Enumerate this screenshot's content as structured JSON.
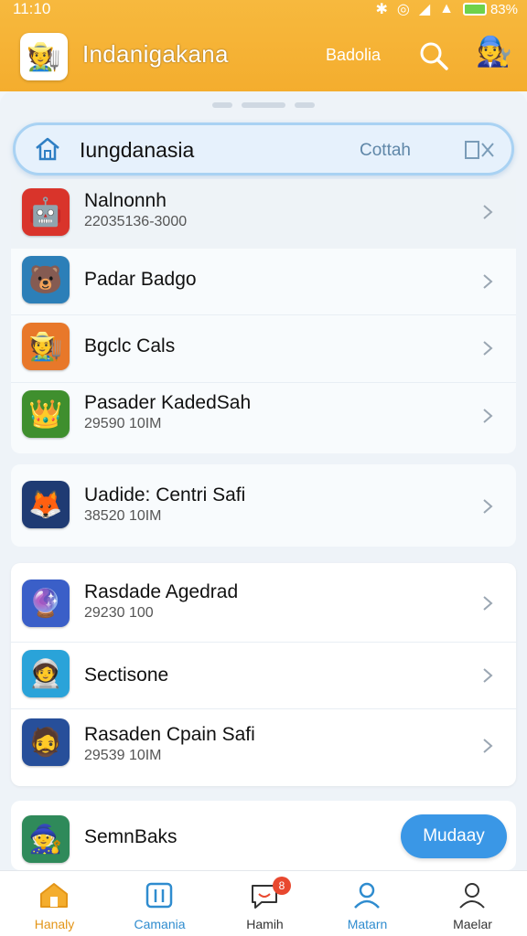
{
  "status_bar": {
    "time": "11:10",
    "battery": "83%"
  },
  "header": {
    "title": "Indanigakana",
    "link": "Badolia",
    "logo_icon": "game-character-icon",
    "avatar_icon": "character-avatar-icon"
  },
  "search": {
    "query": "Iungdanasia",
    "action": "Cottah"
  },
  "items": [
    {
      "title": "Nalnonnh",
      "subtitle": "22035136-3000",
      "icon": "🤖",
      "bg": "#d9342b"
    },
    {
      "title": "Padar Badgo",
      "subtitle": "",
      "icon": "🐻",
      "bg": "#2c7fb8"
    },
    {
      "title": "Bgclc Cals",
      "subtitle": "",
      "icon": "🧑‍🌾",
      "bg": "#e8782a"
    },
    {
      "title": "Pasader KadedSah",
      "subtitle": "29590 10IM",
      "icon": "👑",
      "bg": "#3f8f2e"
    },
    {
      "title": "Uadide: Centri Safi",
      "subtitle": "38520 10IM",
      "icon": "🦊",
      "bg": "#1f3b73"
    },
    {
      "title": "Rasdade Agedrad",
      "subtitle": "29230 100",
      "icon": "🔮",
      "bg": "#3a5fc8"
    },
    {
      "title": "Sectisone",
      "subtitle": "",
      "icon": "🧑‍🚀",
      "bg": "#2aa3d9"
    },
    {
      "title": "Rasaden Cpain Safi",
      "subtitle": "29539 10IM",
      "icon": "🧔",
      "bg": "#274f9a"
    },
    {
      "title": "SemnBaks",
      "subtitle": "",
      "icon": "🧙",
      "bg": "#2f8a5a"
    }
  ],
  "primary_button": "Mudaay",
  "nav": [
    {
      "label": "Hanaly",
      "active": true
    },
    {
      "label": "Camania",
      "active": false
    },
    {
      "label": "Hamih",
      "badge": "8",
      "active": false
    },
    {
      "label": "Matarn",
      "active": false
    },
    {
      "label": "Maelar",
      "active": false
    }
  ],
  "colors": {
    "header": "#f4ad2e",
    "accent": "#3a97e6",
    "badge": "#e8482f"
  }
}
